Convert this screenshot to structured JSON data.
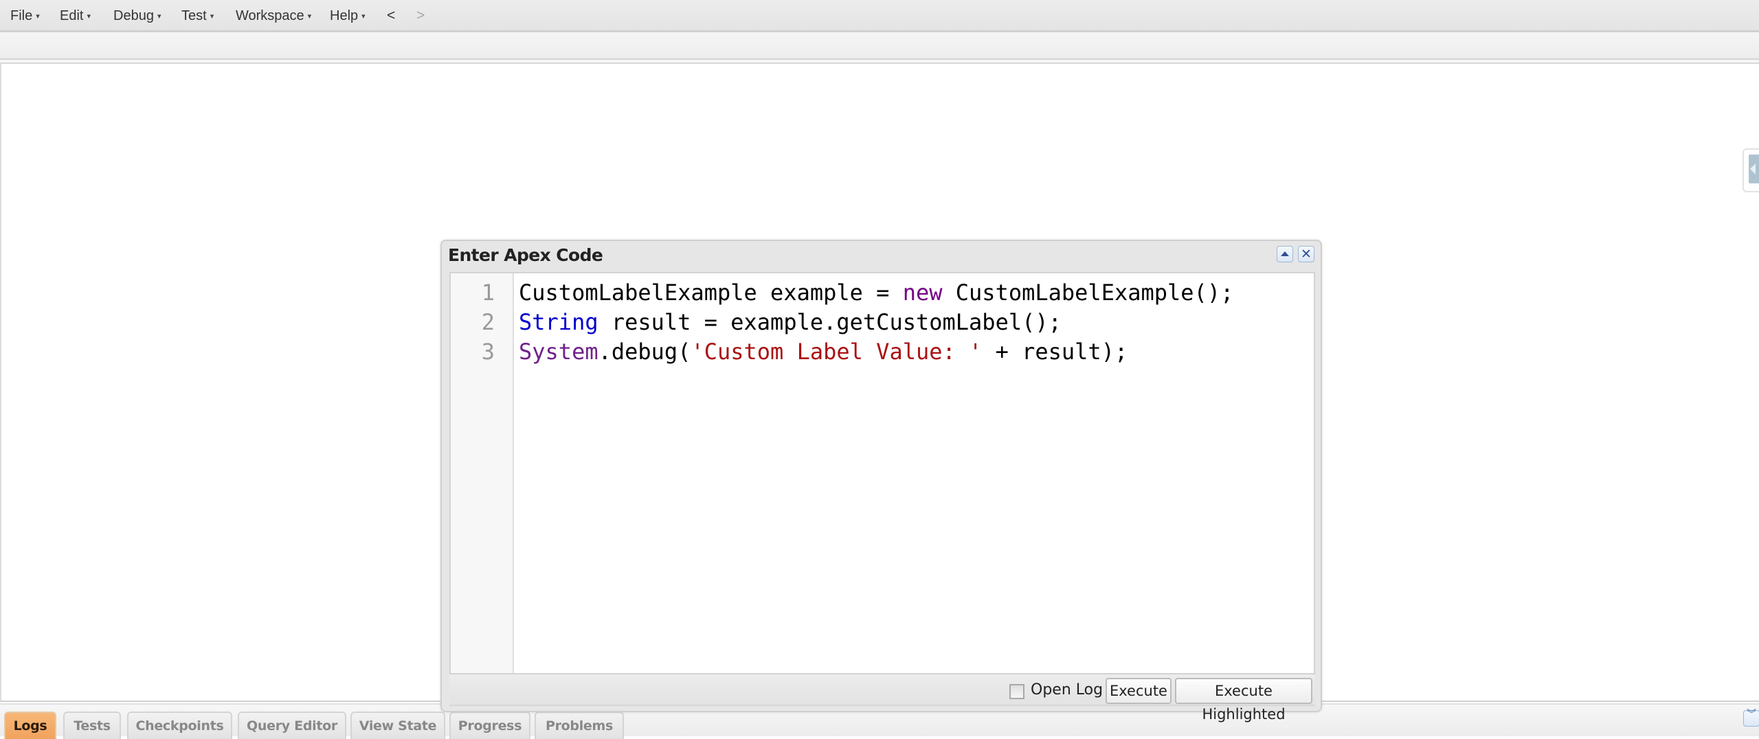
{
  "menubar": {
    "items": [
      {
        "label": "File"
      },
      {
        "label": "Edit"
      },
      {
        "label": "Debug"
      },
      {
        "label": "Test"
      },
      {
        "label": "Workspace"
      },
      {
        "label": "Help"
      }
    ],
    "caret": "▾",
    "back": "<",
    "forward": ">"
  },
  "dialog": {
    "title": "Enter Apex Code",
    "close_glyph": "✕",
    "line_numbers": [
      "1",
      "2",
      "3"
    ],
    "code_lines": [
      [
        {
          "text": "CustomLabelExample example = ",
          "style": "plain"
        },
        {
          "text": "new",
          "style": "keyword"
        },
        {
          "text": " CustomLabelExample();",
          "style": "plain"
        }
      ],
      [
        {
          "text": "String",
          "style": "type"
        },
        {
          "text": " result = example.getCustomLabel();",
          "style": "plain"
        }
      ],
      [
        {
          "text": "System",
          "style": "system"
        },
        {
          "text": ".debug(",
          "style": "plain"
        },
        {
          "text": "'Custom Label Value: '",
          "style": "string"
        },
        {
          "text": " + result);",
          "style": "plain"
        }
      ]
    ],
    "open_log_label": "Open Log",
    "open_log_checked": false,
    "execute_label": "Execute",
    "execute_highlighted_label": "Execute Highlighted"
  },
  "bottom_tabs": [
    {
      "label": "Logs",
      "active": true
    },
    {
      "label": "Tests",
      "active": false
    },
    {
      "label": "Checkpoints",
      "active": false
    },
    {
      "label": "Query Editor",
      "active": false
    },
    {
      "label": "View State",
      "active": false
    },
    {
      "label": "Progress",
      "active": false
    },
    {
      "label": "Problems",
      "active": false
    }
  ],
  "colors": {
    "active_tab": "#f0a35d",
    "keyword": "#770088",
    "type": "#0000cc",
    "string": "#aa1111"
  }
}
